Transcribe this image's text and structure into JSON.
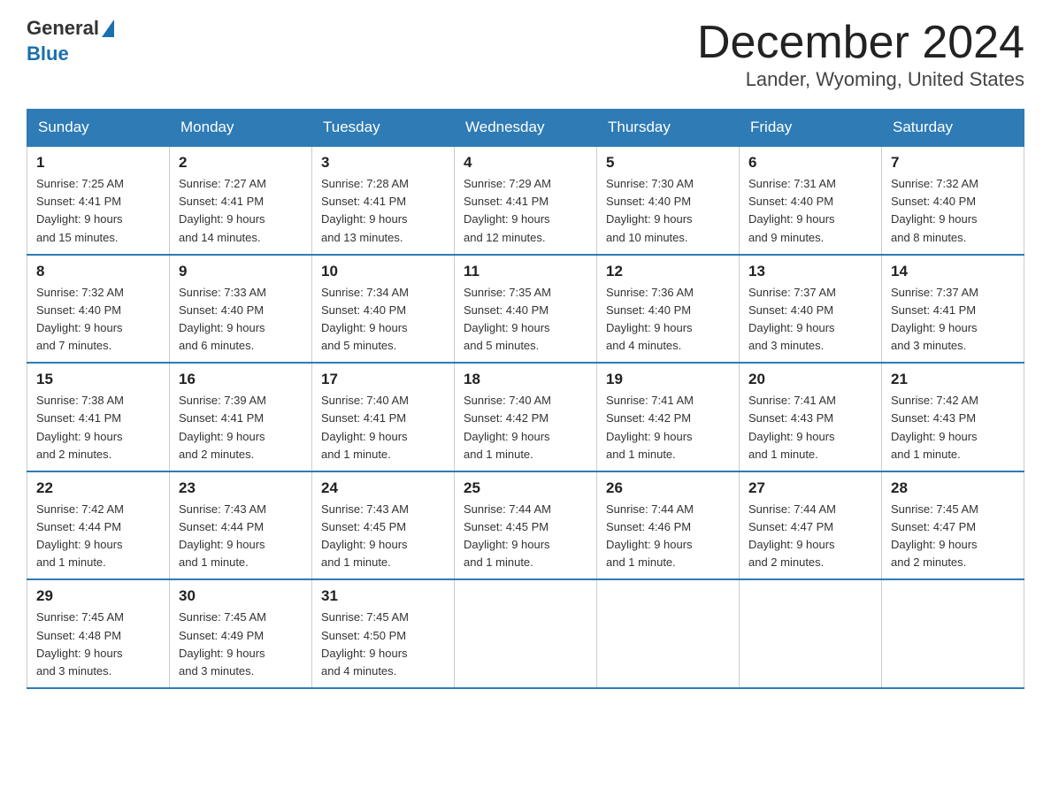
{
  "header": {
    "logo": {
      "general": "General",
      "blue": "Blue"
    },
    "title": "December 2024",
    "location": "Lander, Wyoming, United States"
  },
  "calendar": {
    "days_of_week": [
      "Sunday",
      "Monday",
      "Tuesday",
      "Wednesday",
      "Thursday",
      "Friday",
      "Saturday"
    ],
    "weeks": [
      [
        {
          "day": "1",
          "sunrise": "7:25 AM",
          "sunset": "4:41 PM",
          "daylight": "9 hours and 15 minutes."
        },
        {
          "day": "2",
          "sunrise": "7:27 AM",
          "sunset": "4:41 PM",
          "daylight": "9 hours and 14 minutes."
        },
        {
          "day": "3",
          "sunrise": "7:28 AM",
          "sunset": "4:41 PM",
          "daylight": "9 hours and 13 minutes."
        },
        {
          "day": "4",
          "sunrise": "7:29 AM",
          "sunset": "4:41 PM",
          "daylight": "9 hours and 12 minutes."
        },
        {
          "day": "5",
          "sunrise": "7:30 AM",
          "sunset": "4:40 PM",
          "daylight": "9 hours and 10 minutes."
        },
        {
          "day": "6",
          "sunrise": "7:31 AM",
          "sunset": "4:40 PM",
          "daylight": "9 hours and 9 minutes."
        },
        {
          "day": "7",
          "sunrise": "7:32 AM",
          "sunset": "4:40 PM",
          "daylight": "9 hours and 8 minutes."
        }
      ],
      [
        {
          "day": "8",
          "sunrise": "7:32 AM",
          "sunset": "4:40 PM",
          "daylight": "9 hours and 7 minutes."
        },
        {
          "day": "9",
          "sunrise": "7:33 AM",
          "sunset": "4:40 PM",
          "daylight": "9 hours and 6 minutes."
        },
        {
          "day": "10",
          "sunrise": "7:34 AM",
          "sunset": "4:40 PM",
          "daylight": "9 hours and 5 minutes."
        },
        {
          "day": "11",
          "sunrise": "7:35 AM",
          "sunset": "4:40 PM",
          "daylight": "9 hours and 5 minutes."
        },
        {
          "day": "12",
          "sunrise": "7:36 AM",
          "sunset": "4:40 PM",
          "daylight": "9 hours and 4 minutes."
        },
        {
          "day": "13",
          "sunrise": "7:37 AM",
          "sunset": "4:40 PM",
          "daylight": "9 hours and 3 minutes."
        },
        {
          "day": "14",
          "sunrise": "7:37 AM",
          "sunset": "4:41 PM",
          "daylight": "9 hours and 3 minutes."
        }
      ],
      [
        {
          "day": "15",
          "sunrise": "7:38 AM",
          "sunset": "4:41 PM",
          "daylight": "9 hours and 2 minutes."
        },
        {
          "day": "16",
          "sunrise": "7:39 AM",
          "sunset": "4:41 PM",
          "daylight": "9 hours and 2 minutes."
        },
        {
          "day": "17",
          "sunrise": "7:40 AM",
          "sunset": "4:41 PM",
          "daylight": "9 hours and 1 minute."
        },
        {
          "day": "18",
          "sunrise": "7:40 AM",
          "sunset": "4:42 PM",
          "daylight": "9 hours and 1 minute."
        },
        {
          "day": "19",
          "sunrise": "7:41 AM",
          "sunset": "4:42 PM",
          "daylight": "9 hours and 1 minute."
        },
        {
          "day": "20",
          "sunrise": "7:41 AM",
          "sunset": "4:43 PM",
          "daylight": "9 hours and 1 minute."
        },
        {
          "day": "21",
          "sunrise": "7:42 AM",
          "sunset": "4:43 PM",
          "daylight": "9 hours and 1 minute."
        }
      ],
      [
        {
          "day": "22",
          "sunrise": "7:42 AM",
          "sunset": "4:44 PM",
          "daylight": "9 hours and 1 minute."
        },
        {
          "day": "23",
          "sunrise": "7:43 AM",
          "sunset": "4:44 PM",
          "daylight": "9 hours and 1 minute."
        },
        {
          "day": "24",
          "sunrise": "7:43 AM",
          "sunset": "4:45 PM",
          "daylight": "9 hours and 1 minute."
        },
        {
          "day": "25",
          "sunrise": "7:44 AM",
          "sunset": "4:45 PM",
          "daylight": "9 hours and 1 minute."
        },
        {
          "day": "26",
          "sunrise": "7:44 AM",
          "sunset": "4:46 PM",
          "daylight": "9 hours and 1 minute."
        },
        {
          "day": "27",
          "sunrise": "7:44 AM",
          "sunset": "4:47 PM",
          "daylight": "9 hours and 2 minutes."
        },
        {
          "day": "28",
          "sunrise": "7:45 AM",
          "sunset": "4:47 PM",
          "daylight": "9 hours and 2 minutes."
        }
      ],
      [
        {
          "day": "29",
          "sunrise": "7:45 AM",
          "sunset": "4:48 PM",
          "daylight": "9 hours and 3 minutes."
        },
        {
          "day": "30",
          "sunrise": "7:45 AM",
          "sunset": "4:49 PM",
          "daylight": "9 hours and 3 minutes."
        },
        {
          "day": "31",
          "sunrise": "7:45 AM",
          "sunset": "4:50 PM",
          "daylight": "9 hours and 4 minutes."
        },
        null,
        null,
        null,
        null
      ]
    ],
    "labels": {
      "sunrise": "Sunrise:",
      "sunset": "Sunset:",
      "daylight": "Daylight:"
    }
  }
}
